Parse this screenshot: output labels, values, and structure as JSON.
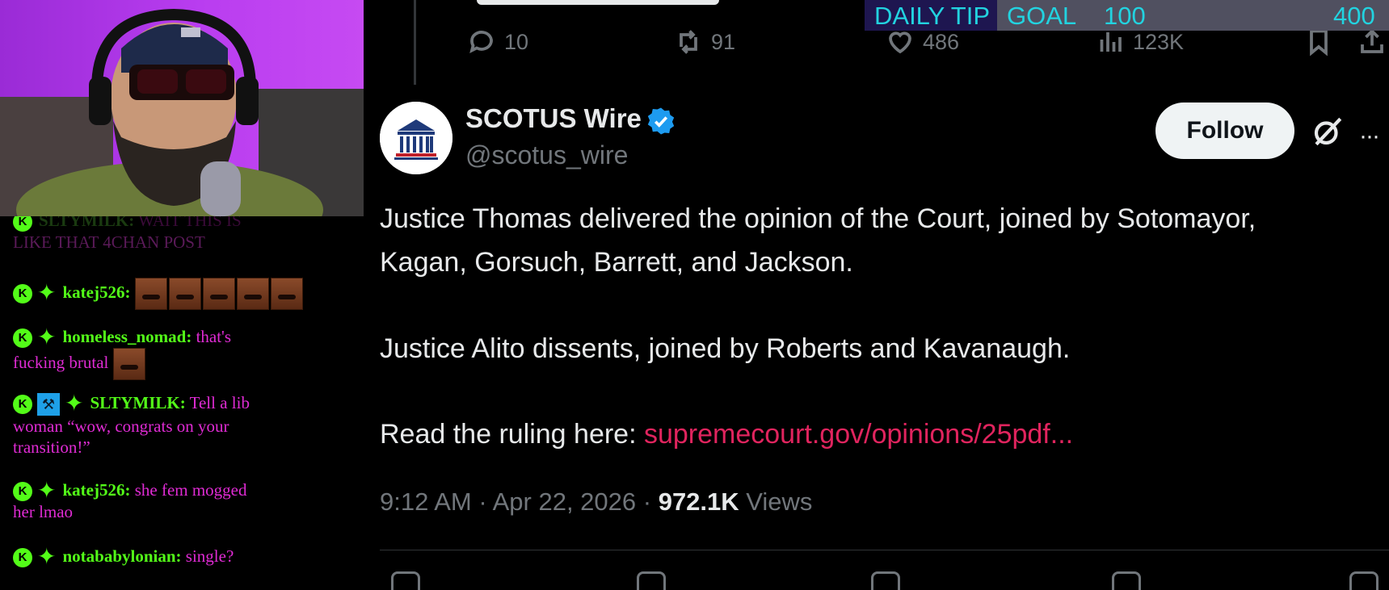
{
  "overlay": {
    "goal_title": "DAILY TIP",
    "goal_label": "GOAL",
    "goal_current": "100",
    "goal_target": "400",
    "goal_progress_fraction": 0.25
  },
  "previous_tweet": {
    "replies": "10",
    "reposts": "91",
    "likes": "486",
    "views": "123K"
  },
  "tweet": {
    "author_name": "SCOTUS Wire",
    "handle": "@scotus_wire",
    "follow_label": "Follow",
    "line1": "Justice Thomas delivered the opinion of the Court, joined by Sotomayor,",
    "line2": "Kagan, Gorsuch, Barrett, and Jackson.",
    "line3": "Justice Alito dissents, joined by Roberts and Kavanaugh.",
    "read_prefix": "Read the ruling here: ",
    "link_text": "supremecourt.gov/opinions/25pdf...",
    "time": "9:12 AM",
    "date": "Apr 22, 2026",
    "views_count": "972.1K",
    "views_label": "Views"
  },
  "chat": {
    "partial_user": "SLTYMILK:",
    "partial_text": "WAIT THIS IS",
    "partial_cont": "LIKE THAT 4CHAN POST",
    "messages": [
      {
        "user": "katej526:",
        "text": ""
      },
      {
        "user": "homeless_nomad:",
        "text": "that's",
        "cont": "fucking brutal"
      },
      {
        "user": "SLTYMILK:",
        "text": "Tell a lib",
        "cont": "woman “wow, congrats on your",
        "cont2": "transition!”"
      },
      {
        "user": "katej526:",
        "text": "she fem mogged",
        "cont": "her lmao"
      },
      {
        "user": "notababylonian:",
        "text": "single?"
      }
    ]
  },
  "colors": {
    "chat_username": "#53fc18",
    "chat_text": "#e02bd4",
    "link": "#e0245e",
    "verified": "#1d9bf0",
    "goal_text": "#22d3e0"
  }
}
